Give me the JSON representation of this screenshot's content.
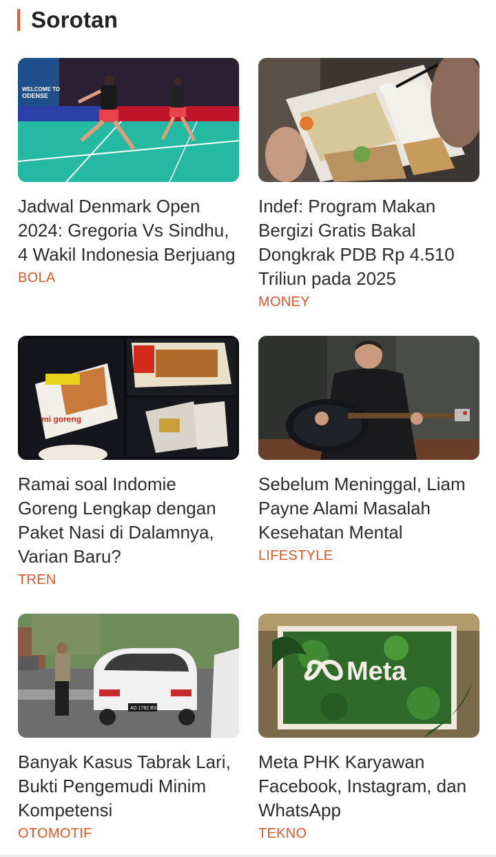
{
  "section": {
    "title": "Sorotan",
    "accent": "#e05a2b"
  },
  "articles": [
    {
      "title": "Jadwal Denmark Open 2024: Gregoria Vs Sindhu, 4 Wakil Indonesia Berjuang",
      "category": "BOLA",
      "image": "badminton-match-photo",
      "banner_text": [
        "WELCOME TO",
        "ODENSE"
      ]
    },
    {
      "title": "Indef: Program Makan Bergizi Gratis Bakal Dongkrak PDB Rp 4.510 Triliun pada 2025",
      "category": "MONEY",
      "image": "meal-box-photo"
    },
    {
      "title": "Ramai soal Indomie Goreng Lengkap dengan Paket Nasi di Dalamnya, Varian Baru?",
      "category": "TREN",
      "image": "instant-noodle-packet-photo",
      "package_text": "mi goreng"
    },
    {
      "title": "Sebelum Meninggal, Liam Payne Alami Masalah Kesehatan Mental",
      "category": "LIFESTYLE",
      "image": "guitarist-photo"
    },
    {
      "title": "Banyak Kasus Tabrak Lari, Bukti Pengemudi Minim Kompetensi",
      "category": "OTOMOTIF",
      "image": "damaged-car-photo",
      "plate_text": "AD 1782 BX"
    },
    {
      "title": "Meta PHK Karyawan Facebook, Instagram, dan WhatsApp",
      "category": "TEKNO",
      "image": "meta-logo-moss-sign-photo",
      "logo_text": "Meta"
    }
  ]
}
